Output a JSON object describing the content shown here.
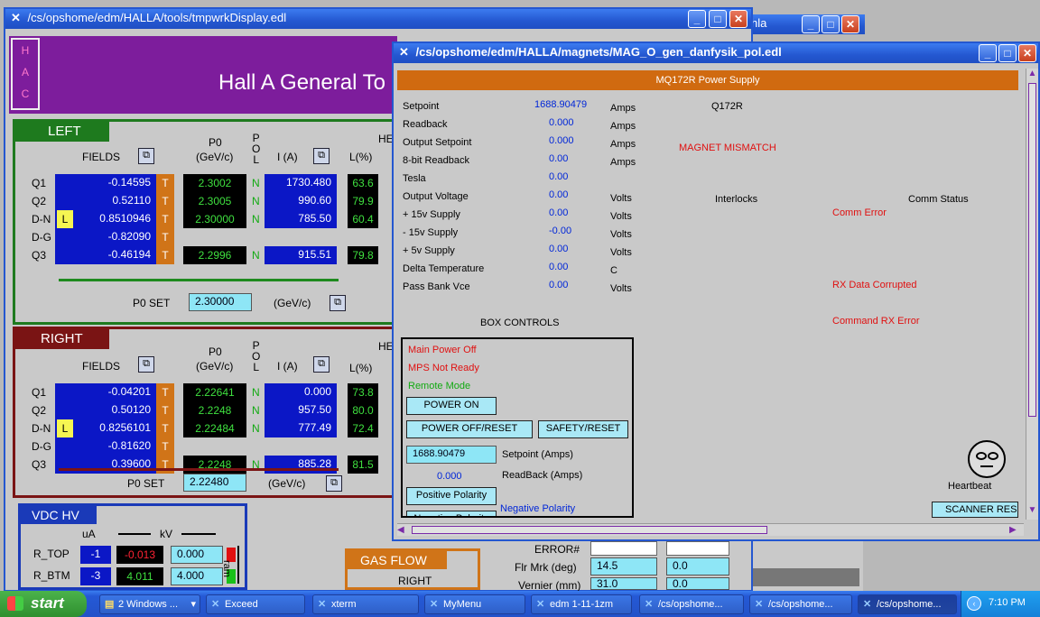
{
  "bg_window": {
    "title_fragment": "hla"
  },
  "left_window": {
    "title": "/cs/opshome/edm/HALLA/tools/tmpwrkDisplay.edl",
    "header_title": "Hall A General To",
    "hac_letters": [
      "H",
      "A",
      "C"
    ],
    "left": {
      "label": "LEFT",
      "col_fields": "FIELDS",
      "col_p0": "P0",
      "col_p0_unit": "(GeV/c)",
      "col_pol": [
        "P",
        "O",
        "L"
      ],
      "col_i": "I (A)",
      "col_l": "L(%)",
      "col_he": "HE",
      "rows": [
        {
          "name": "Q1",
          "field": "-0.14595",
          "t": "T",
          "p0": "2.3002",
          "pol": "N",
          "i": "1730.480",
          "l": "63.6",
          "l_flag": ""
        },
        {
          "name": "Q2",
          "field": "0.52110",
          "t": "T",
          "p0": "2.3005",
          "pol": "N",
          "i": "990.60",
          "l": "79.9",
          "l_flag": ""
        },
        {
          "name": "D-N",
          "field": "0.8510946",
          "t": "T",
          "p0": "2.30000",
          "pol": "N",
          "i": "785.50",
          "l": "60.4",
          "l_flag": "L"
        },
        {
          "name": "D-G",
          "field": "-0.82090",
          "t": "T",
          "p0": "",
          "pol": "",
          "i": "",
          "l": "",
          "l_flag": ""
        },
        {
          "name": "Q3",
          "field": "-0.46194",
          "t": "T",
          "p0": "2.2996",
          "pol": "N",
          "i": "915.51",
          "l": "79.8",
          "l_flag": ""
        }
      ],
      "p0set_label": "P0 SET",
      "p0set_value": "2.30000",
      "p0set_unit": "(GeV/c)"
    },
    "right": {
      "label": "RIGHT",
      "col_fields": "FIELDS",
      "col_p0": "P0",
      "col_p0_unit": "(GeV/c)",
      "col_pol": [
        "P",
        "O",
        "L"
      ],
      "col_i": "I (A)",
      "col_l": "L(%)",
      "col_he": "HE",
      "rows": [
        {
          "name": "Q1",
          "field": "-0.04201",
          "t": "T",
          "p0": "2.22641",
          "pol": "N",
          "i": "0.000",
          "l": "73.8",
          "l_flag": ""
        },
        {
          "name": "Q2",
          "field": "0.50120",
          "t": "T",
          "p0": "2.2248",
          "pol": "N",
          "i": "957.50",
          "l": "80.0",
          "l_flag": ""
        },
        {
          "name": "D-N",
          "field": "0.8256101",
          "t": "T",
          "p0": "2.22484",
          "pol": "N",
          "i": "777.49",
          "l": "72.4",
          "l_flag": "L"
        },
        {
          "name": "D-G",
          "field": "-0.81620",
          "t": "T",
          "p0": "",
          "pol": "",
          "i": "",
          "l": "",
          "l_flag": ""
        },
        {
          "name": "Q3",
          "field": "0.39600",
          "t": "T",
          "p0": "2.2248",
          "pol": "N",
          "i": "885.28",
          "l": "81.5",
          "l_flag": ""
        }
      ],
      "p0set_label": "P0 SET",
      "p0set_value": "2.22480",
      "p0set_unit": "(GeV/c)"
    },
    "vdc": {
      "title": "VDC HV",
      "ua": "uA",
      "kv": "kV",
      "ram": "ram",
      "rows": [
        {
          "name": "R_TOP",
          "ua": "-1",
          "kv": "-0.013",
          "set": "0.000"
        },
        {
          "name": "R_BTM",
          "ua": "-3",
          "kv": "4.011",
          "set": "4.000"
        }
      ]
    },
    "gas": {
      "title": "GAS FLOW",
      "right": "RIGHT"
    },
    "lower": {
      "error": "ERROR#",
      "flr_label": "Flr Mrk (deg)",
      "flr_value": "14.5",
      "flr_value2": "0.0",
      "vernier_label": "Vernier (mm)",
      "vernier_value": "31.0",
      "vernier_value2": "0.0"
    }
  },
  "magnet_window": {
    "title": "/cs/opshome/edm/HALLA/magnets/MAG_O_gen_danfysik_pol.edl",
    "header": "MQ172R Power Supply",
    "magnet_name": "Q172R",
    "mismatch": "MAGNET MISMATCH",
    "readings": [
      {
        "label": "Setpoint",
        "value": "1688.90479",
        "unit": "Amps"
      },
      {
        "label": "Readback",
        "value": "0.000",
        "unit": "Amps"
      },
      {
        "label": "Output Setpoint",
        "value": "0.000",
        "unit": "Amps"
      },
      {
        "label": "8-bit Readback",
        "value": "0.00",
        "unit": "Amps"
      },
      {
        "label": "Tesla",
        "value": "0.00",
        "unit": ""
      },
      {
        "label": "Output Voltage",
        "value": "0.00",
        "unit": "Volts"
      },
      {
        "label": "+ 15v Supply",
        "value": "0.00",
        "unit": "Volts"
      },
      {
        "label": "- 15v Supply",
        "value": "-0.00",
        "unit": "Volts"
      },
      {
        "label": "+ 5v Supply",
        "value": "0.00",
        "unit": "Volts"
      },
      {
        "label": "Delta Temperature",
        "value": "0.00",
        "unit": "C"
      },
      {
        "label": "Pass Bank Vce",
        "value": "0.00",
        "unit": "Volts"
      }
    ],
    "interlocks": "Interlocks",
    "comm_status": "Comm Status",
    "comm_error": "Comm Error",
    "rx_corrupted": "RX Data Corrupted",
    "cmd_rx_error": "Command RX Error",
    "box_controls": "BOX CONTROLS",
    "main_power": "Main Power Off",
    "mps": "MPS Not Ready",
    "remote": "Remote Mode",
    "power_on": "POWER ON",
    "power_off": "POWER OFF/RESET",
    "safety": "SAFETY/RESET",
    "setpoint_input": "1688.90479",
    "setpoint_label": "Setpoint (Amps)",
    "readback_value": "0.000",
    "readback_label": "ReadBack (Amps)",
    "pos_polarity": "Positive Polarity",
    "neg_polarity_btn": "Negative Polarity",
    "neg_polarity": "Negative Polarity",
    "heartbeat": "Heartbeat",
    "scanner_reset": "SCANNER RESE"
  },
  "taskbar": {
    "start": "start",
    "items": [
      "2 Windows ...",
      "Exceed",
      "xterm",
      "MyMenu",
      "edm 1-11-1zm",
      "/cs/opshome...",
      "/cs/opshome...",
      "/cs/opshome..."
    ],
    "clock": "7:10 PM"
  },
  "colors": {
    "purple": "#7d1d9c",
    "green": "#1e7a1e",
    "maroon": "#7a1414",
    "magnet_orange": "#d06a10",
    "field_blue": "#0b17c6"
  }
}
